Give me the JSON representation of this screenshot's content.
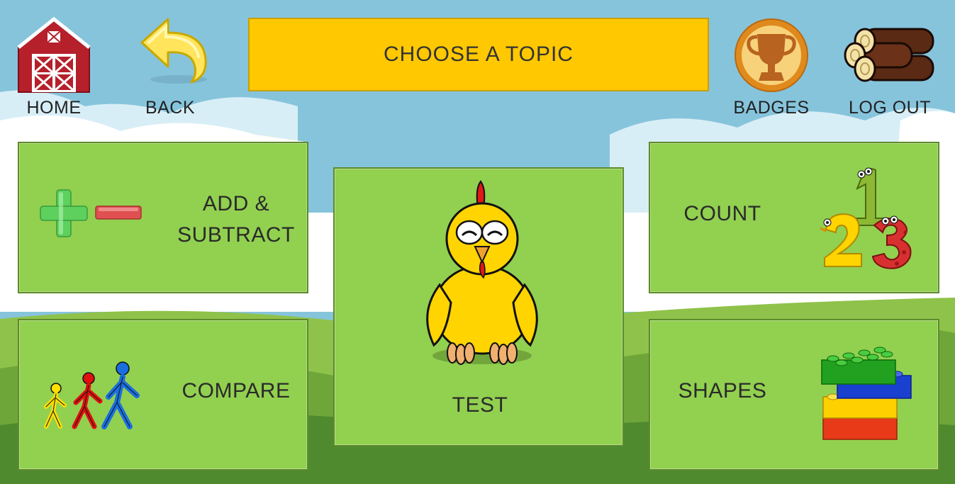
{
  "header": {
    "title": "CHOOSE A TOPIC",
    "home_label": "HOME",
    "back_label": "BACK",
    "badges_label": "BADGES",
    "logout_label": "LOG OUT"
  },
  "topics": {
    "add_subtract": {
      "line1": "ADD &",
      "line2": "SUBTRACT"
    },
    "compare": {
      "label": "COMPARE"
    },
    "test": {
      "label": "TEST"
    },
    "count": {
      "label": "COUNT"
    },
    "shapes": {
      "label": "SHAPES"
    }
  },
  "icons": {
    "home": "barn-icon",
    "back": "back-arrow-icon",
    "badges": "trophy-icon",
    "logout": "logs-icon",
    "add_subtract": "plus-minus-icon",
    "compare": "walking-people-icon",
    "test": "chicken-icon",
    "count": "numbers-123-icon",
    "shapes": "blocks-icon"
  },
  "colors": {
    "title_bar": "#ffc800",
    "tile": "#92d050",
    "sky": "#86c4dc"
  }
}
